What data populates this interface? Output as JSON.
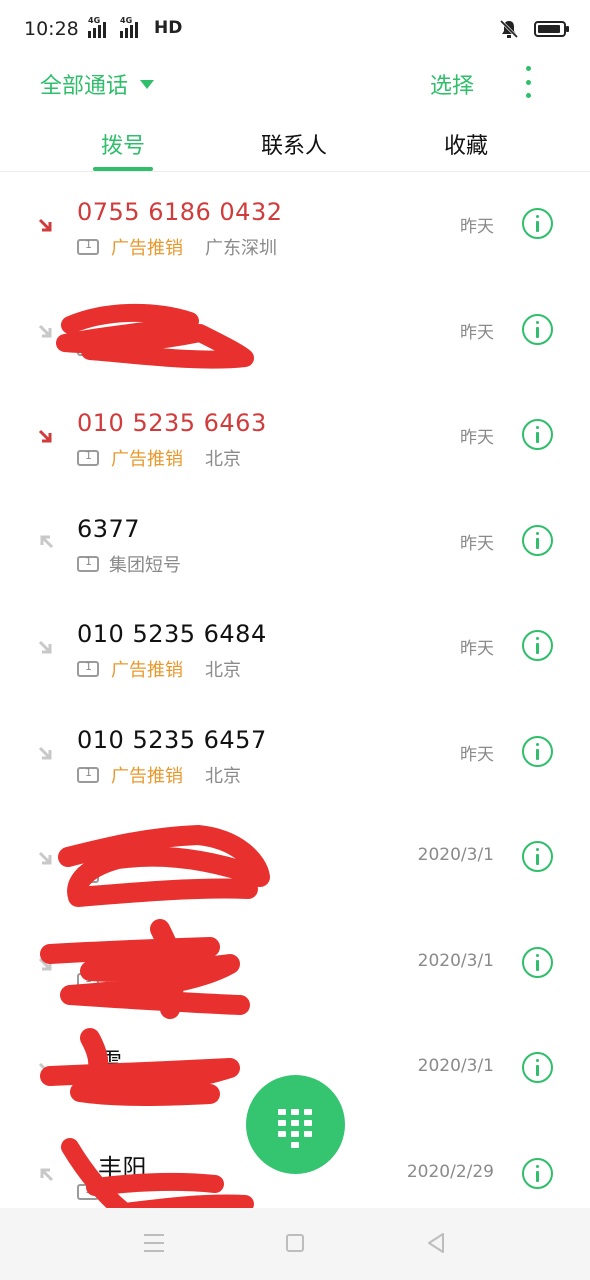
{
  "status": {
    "time": "10:28",
    "network_1": "4G",
    "network_2": "4G",
    "hd": "HD"
  },
  "header": {
    "filter_label": "全部通话",
    "select_label": "选择"
  },
  "tabs": [
    {
      "label": "拨号",
      "active": true
    },
    {
      "label": "联系人",
      "active": false
    },
    {
      "label": "收藏",
      "active": false
    }
  ],
  "calls": [
    {
      "name": "0755 6186 0432",
      "missed": true,
      "tag": "广告推销",
      "location": "广东深圳",
      "time": "昨天"
    },
    {
      "name": "",
      "missed": false,
      "tag": "",
      "location": "",
      "time": "昨天"
    },
    {
      "name": "010 5235 6463",
      "missed": true,
      "tag": "广告推销",
      "location": "北京",
      "time": "昨天"
    },
    {
      "name": "6377",
      "missed": false,
      "tag": "",
      "location": "集团短号",
      "time": "昨天"
    },
    {
      "name": "010 5235 6484",
      "missed": false,
      "tag": "广告推销",
      "location": "北京",
      "time": "昨天"
    },
    {
      "name": "010 5235 6457",
      "missed": false,
      "tag": "广告推销",
      "location": "北京",
      "time": "昨天"
    },
    {
      "name": "",
      "missed": false,
      "tag": "",
      "location": "",
      "time": "2020/3/1"
    },
    {
      "name": "",
      "missed": false,
      "tag": "",
      "location": "",
      "time": "2020/3/1"
    },
    {
      "name": "雷",
      "missed": false,
      "tag": "",
      "location": "",
      "time": "2020/3/1"
    },
    {
      "name": "丰阳",
      "missed": false,
      "tag": "",
      "location": "",
      "time": "2020/2/29"
    }
  ],
  "colors": {
    "accent": "#2fbf6b",
    "missed": "#d23b3b",
    "ad_tag": "#e8992e",
    "redaction": "#e8312e"
  }
}
